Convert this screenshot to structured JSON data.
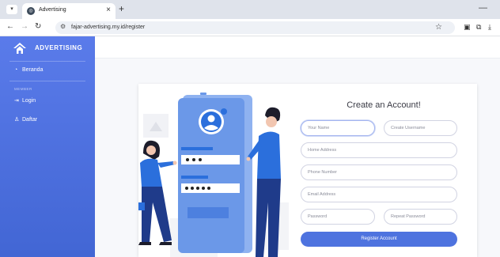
{
  "browser": {
    "tab_title": "Advertising",
    "tab_close": "×",
    "new_tab": "+",
    "minimize": "—",
    "url": "fajar-advertising.my.id/register"
  },
  "sidebar": {
    "brand": "ADVERTISING",
    "items": [
      {
        "label": "Beranda",
        "icon": "gauge-icon"
      },
      {
        "label": "Login",
        "icon": "sign-in-icon"
      },
      {
        "label": "Daftar",
        "icon": "user-plus-icon"
      }
    ],
    "heading": "MEMBER"
  },
  "form": {
    "title": "Create an Account!",
    "your_name": "Your Name",
    "create_username": "Create Username",
    "home_address": "Home Address",
    "phone_number": "Phone Number",
    "email_address": "Email Address",
    "password": "Password",
    "repeat_password": "Repeat Password",
    "submit": "Register Account"
  },
  "colors": {
    "sidebar": "#4e73df",
    "primary": "#4e73df",
    "illustration_accent": "#2b6fdc"
  }
}
